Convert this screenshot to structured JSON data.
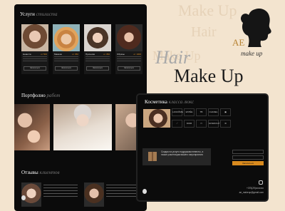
{
  "background_words": [
    "Make Up",
    "Hair",
    "Make Up",
    "Hair",
    "Make Up"
  ],
  "logo": {
    "initials": "AE",
    "tagline": "make up"
  },
  "hero": {
    "line1": "Hair",
    "line2": "Make Up"
  },
  "services": {
    "title": "Услуги",
    "title_accent": "стилиста",
    "cards": [
      {
        "name": "Невеста",
        "price": "от 500"
      },
      {
        "name": "Макияж",
        "price": "от 350"
      },
      {
        "name": "Прически",
        "price": "от 350"
      },
      {
        "name": "Образы",
        "price": "от 1000"
      }
    ],
    "button_label": "Записаться"
  },
  "portfolio": {
    "title": "Портфолио",
    "title_accent": "работ"
  },
  "reviews": {
    "title": "Отзывы",
    "title_accent": "клиентов"
  },
  "cosmetics": {
    "title": "Косметика",
    "title_accent": "класса люкс",
    "brands_row1": [
      "LANCÔME",
      "ESTĒE",
      "TB",
      "CHANEL",
      "▣"
    ],
    "brands_row2": [
      "⟋",
      "DIOR",
      "▭",
      "GIVENCHY",
      "Ⅲ"
    ],
    "promo_text": "Скидка на услуги подружкам невесты, а также участницам вашего мероприятия",
    "submit_label": "Записаться",
    "phone": "+375(29)xxxxxxx",
    "email": "ae_makeup@gmail.com"
  },
  "colors": {
    "accent": "#d98a1e",
    "panel": "#0b0b0b",
    "page_bg": "#f3e4cf"
  }
}
